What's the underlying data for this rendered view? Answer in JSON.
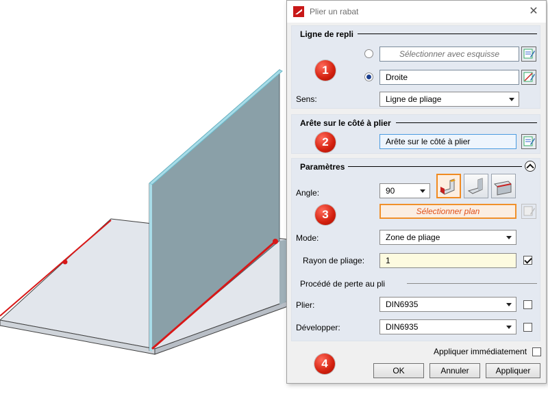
{
  "dialog": {
    "title": "Plier un rabat",
    "close_glyph": "✕"
  },
  "badges": [
    "1",
    "2",
    "3",
    "4"
  ],
  "section1": {
    "title": "Ligne de repli",
    "sketch_placeholder": "Sélectionner avec esquisse",
    "line_value": "Droite",
    "sens_label": "Sens:",
    "sens_value": "Ligne de pliage"
  },
  "section2": {
    "title": "Arête sur le côté à plier",
    "edge_value": "Arête sur le côté à plier"
  },
  "section3": {
    "title": "Paramètres",
    "angle_label": "Angle:",
    "angle_value": "90",
    "select_plane": "Sélectionner plan",
    "mode_label": "Mode:",
    "mode_value": "Zone de pliage",
    "radius_label": "Rayon de pliage:",
    "radius_value": "1",
    "loss_group_title": "Procédé de perte au pli",
    "plier_label": "Plier:",
    "plier_value": "DIN6935",
    "developper_label": "Développer:",
    "developper_value": "DIN6935"
  },
  "footer": {
    "apply_immediately": "Appliquer immédiatement",
    "ok": "OK",
    "cancel": "Annuler",
    "apply": "Appliquer"
  },
  "colors": {
    "panel": "#e4e9f1",
    "badge": "#d3200e",
    "highlight_orange": "#f08a20",
    "edge_red": "#d81818"
  }
}
